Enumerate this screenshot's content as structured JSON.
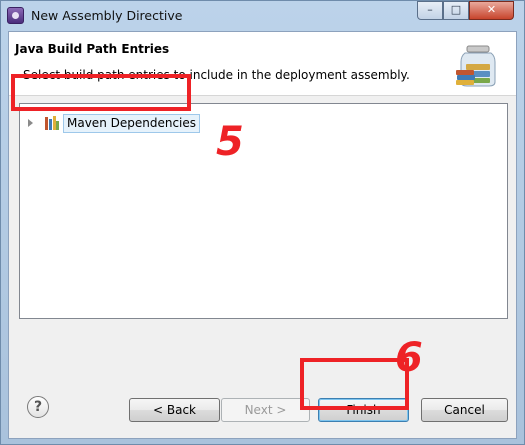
{
  "window": {
    "title": "New Assembly Directive",
    "controls": {
      "minimize": "–",
      "maximize": "□",
      "close": "✕"
    }
  },
  "header": {
    "title": "Java Build Path Entries",
    "description": "Select build path entries to include in the deployment assembly.",
    "banner_icon": "jar-icon"
  },
  "tree": {
    "items": [
      {
        "label": "Maven Dependencies",
        "icon": "library-icon",
        "expanded": false,
        "selected": true
      }
    ]
  },
  "annotations": {
    "step_a": "5",
    "step_b": "6",
    "color": "#ee2226"
  },
  "footer": {
    "help": "?",
    "back": "< Back",
    "next": "Next >",
    "finish": "Finish",
    "cancel": "Cancel"
  }
}
